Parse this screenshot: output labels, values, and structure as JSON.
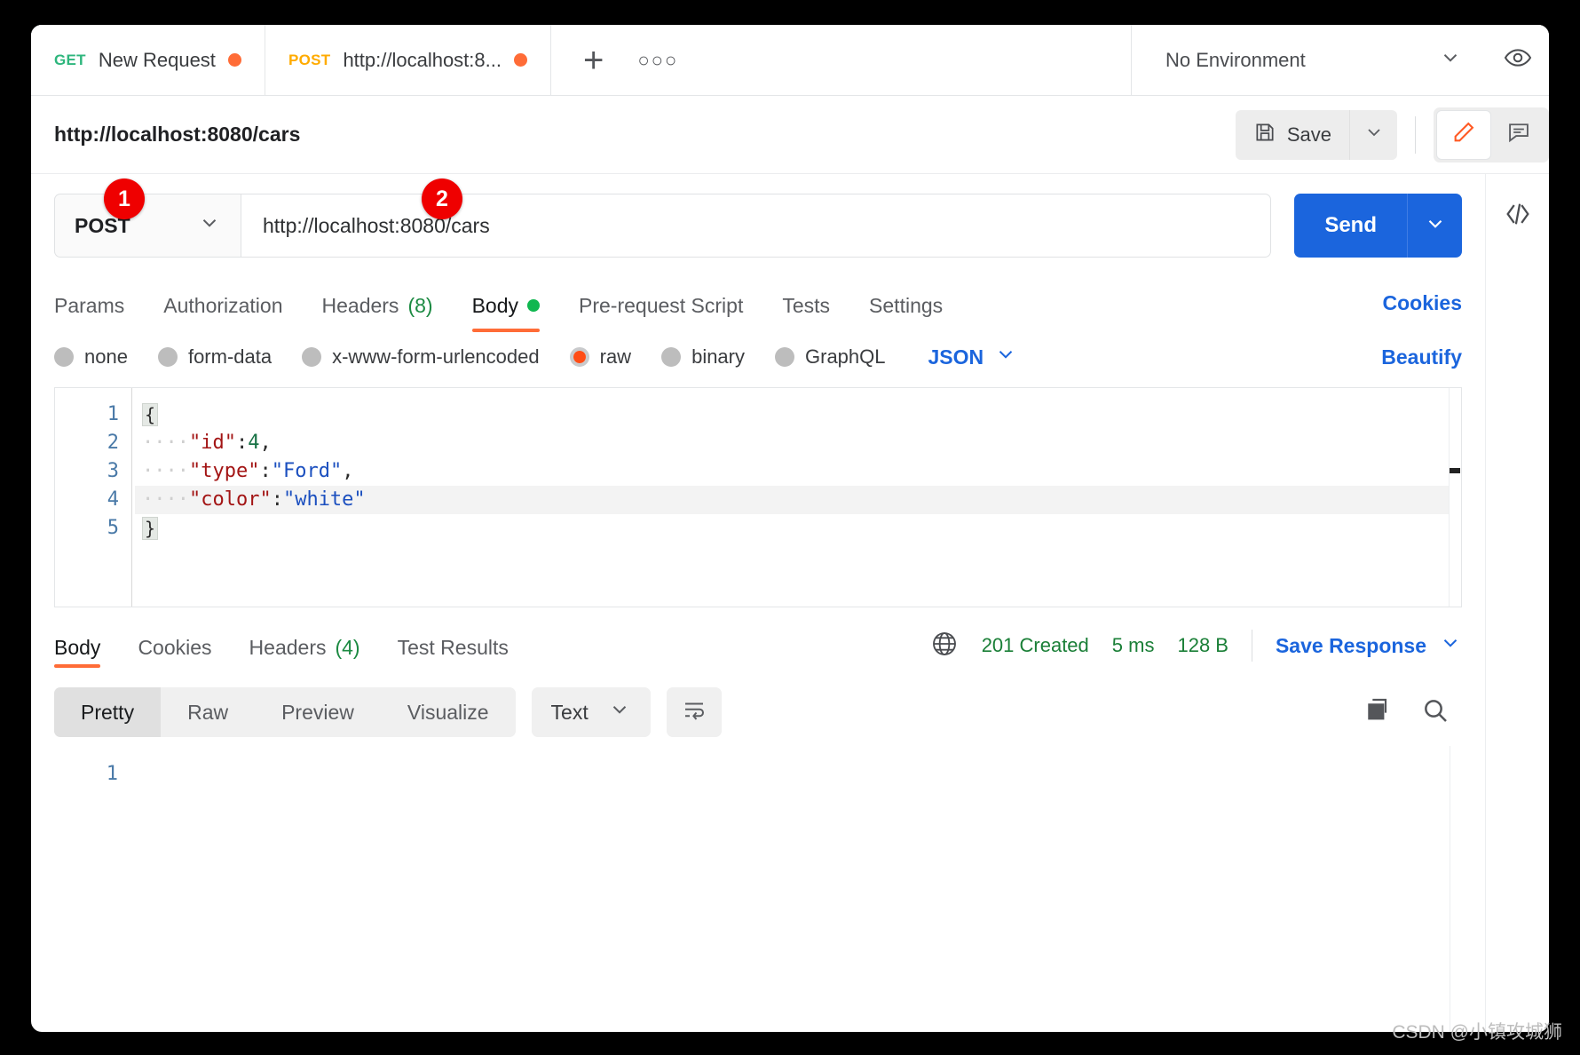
{
  "window": {
    "watermark": "CSDN @小镇攻城狮"
  },
  "tabbar": {
    "tabs": [
      {
        "method": "GET",
        "name": "New Request",
        "unsaved": true
      },
      {
        "method": "POST",
        "name": "http://localhost:8...",
        "unsaved": true
      }
    ],
    "new_tab_icon": "plus-icon",
    "more_icon": "ellipsis-icon",
    "environment": "No Environment",
    "environment_caret": "chevron-down-icon",
    "eye_icon": "eye-icon"
  },
  "namebar": {
    "request_name": "http://localhost:8080/cars",
    "save_label": "Save",
    "save_icon": "floppy-disk-icon",
    "save_caret": "chevron-down-icon",
    "edit_icon": "pencil-icon",
    "comment_icon": "comment-icon"
  },
  "rail": {
    "code_icon": "code-icon"
  },
  "request": {
    "method": "POST",
    "method_caret": "chevron-down-icon",
    "url": "http://localhost:8080/cars",
    "send_label": "Send",
    "send_caret": "chevron-down-icon",
    "badges": [
      {
        "label": "1",
        "target": "method-selector"
      },
      {
        "label": "2",
        "target": "url-input"
      }
    ],
    "tabs": [
      {
        "label": "Params",
        "count": "",
        "active": false,
        "dot": false
      },
      {
        "label": "Authorization",
        "count": "",
        "active": false,
        "dot": false
      },
      {
        "label": "Headers",
        "count": "(8)",
        "active": false,
        "dot": false
      },
      {
        "label": "Body",
        "count": "",
        "active": true,
        "dot": true
      },
      {
        "label": "Pre-request Script",
        "count": "",
        "active": false,
        "dot": false
      },
      {
        "label": "Tests",
        "count": "",
        "active": false,
        "dot": false
      },
      {
        "label": "Settings",
        "count": "",
        "active": false,
        "dot": false
      }
    ],
    "cookies_label": "Cookies"
  },
  "body_type": {
    "options": [
      {
        "label": "none",
        "selected": false
      },
      {
        "label": "form-data",
        "selected": false
      },
      {
        "label": "x-www-form-urlencoded",
        "selected": false
      },
      {
        "label": "raw",
        "selected": true
      },
      {
        "label": "binary",
        "selected": false
      },
      {
        "label": "GraphQL",
        "selected": false
      }
    ],
    "format": "JSON",
    "format_caret": "chevron-down-icon",
    "beautify_label": "Beautify"
  },
  "editor": {
    "line_numbers": [
      "1",
      "2",
      "3",
      "4",
      "5"
    ],
    "lines": [
      {
        "fold": "{",
        "indent": "",
        "key": "",
        "colon": "",
        "value": "",
        "tail": ""
      },
      {
        "fold": "",
        "indent": "····",
        "key": "\"id\"",
        "colon": ":",
        "value": "4",
        "value_type": "number",
        "tail": ","
      },
      {
        "fold": "",
        "indent": "····",
        "key": "\"type\"",
        "colon": ":",
        "value": "\"Ford\"",
        "value_type": "string",
        "tail": ","
      },
      {
        "fold": "",
        "indent": "····",
        "key": "\"color\"",
        "colon": ":",
        "value": "\"white\"",
        "value_type": "string",
        "tail": "",
        "highlight": true
      },
      {
        "fold": "}",
        "indent": "",
        "key": "",
        "colon": "",
        "value": "",
        "tail": ""
      }
    ],
    "raw_text": "{\n    \"id\":4,\n    \"type\":\"Ford\",\n    \"color\":\"white\"\n}"
  },
  "response": {
    "tabs": [
      {
        "label": "Body",
        "count": "",
        "active": true
      },
      {
        "label": "Cookies",
        "count": "",
        "active": false
      },
      {
        "label": "Headers",
        "count": "(4)",
        "active": false
      },
      {
        "label": "Test Results",
        "count": "",
        "active": false
      }
    ],
    "globe_icon": "globe-icon",
    "status": "201 Created",
    "time": "5 ms",
    "size": "128 B",
    "save_response_label": "Save Response",
    "save_response_caret": "chevron-down-icon",
    "view_modes": [
      {
        "label": "Pretty",
        "active": true
      },
      {
        "label": "Raw",
        "active": false
      },
      {
        "label": "Preview",
        "active": false
      },
      {
        "label": "Visualize",
        "active": false
      }
    ],
    "format": "Text",
    "format_caret": "chevron-down-icon",
    "wrap_icon": "word-wrap-icon",
    "copy_icon": "copy-icon",
    "search_icon": "search-icon",
    "line_numbers": [
      "1"
    ],
    "body_lines": [
      ""
    ]
  }
}
